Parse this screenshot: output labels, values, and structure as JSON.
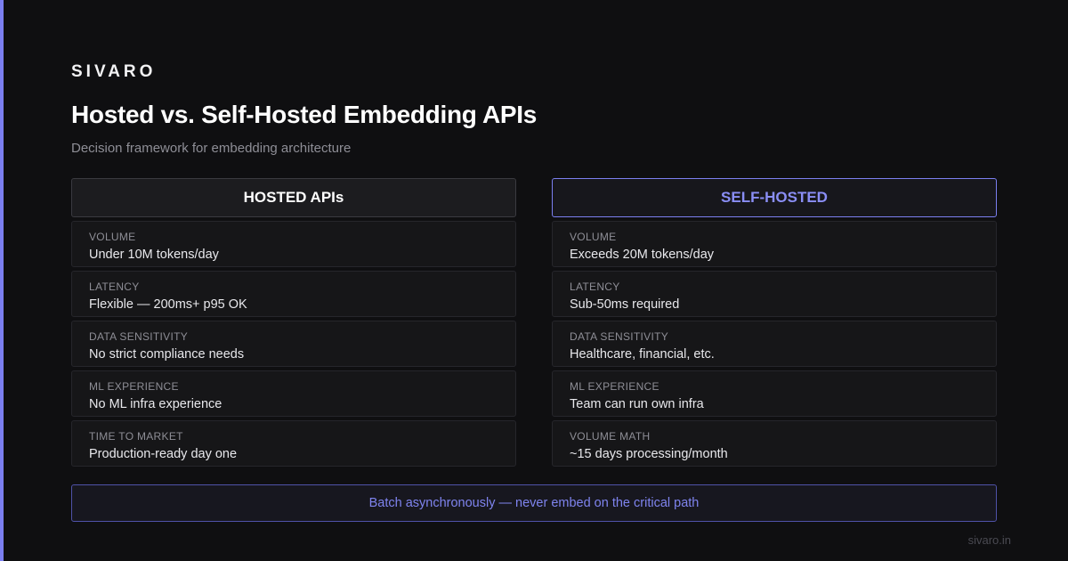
{
  "brand": "SIVARO",
  "title": "Hosted vs. Self-Hosted Embedding APIs",
  "subtitle": "Decision framework for embedding architecture",
  "columns": [
    {
      "header": "HOSTED APIs",
      "rows": [
        {
          "label": "VOLUME",
          "value": "Under 10M tokens/day"
        },
        {
          "label": "LATENCY",
          "value": "Flexible — 200ms+ p95 OK"
        },
        {
          "label": "DATA SENSITIVITY",
          "value": "No strict compliance needs"
        },
        {
          "label": "ML EXPERIENCE",
          "value": "No ML infra experience"
        },
        {
          "label": "TIME TO MARKET",
          "value": "Production-ready day one"
        }
      ]
    },
    {
      "header": "SELF-HOSTED",
      "rows": [
        {
          "label": "VOLUME",
          "value": "Exceeds 20M tokens/day"
        },
        {
          "label": "LATENCY",
          "value": "Sub-50ms required"
        },
        {
          "label": "DATA SENSITIVITY",
          "value": "Healthcare, financial, etc."
        },
        {
          "label": "ML EXPERIENCE",
          "value": "Team can run own infra"
        },
        {
          "label": "VOLUME MATH",
          "value": "~15 days processing/month"
        }
      ]
    }
  ],
  "callout": "Batch asynchronously — never embed on the critical path",
  "footer": "sivaro.in",
  "colors": {
    "accent": "#7b7ff0",
    "background": "#0f0f11"
  }
}
